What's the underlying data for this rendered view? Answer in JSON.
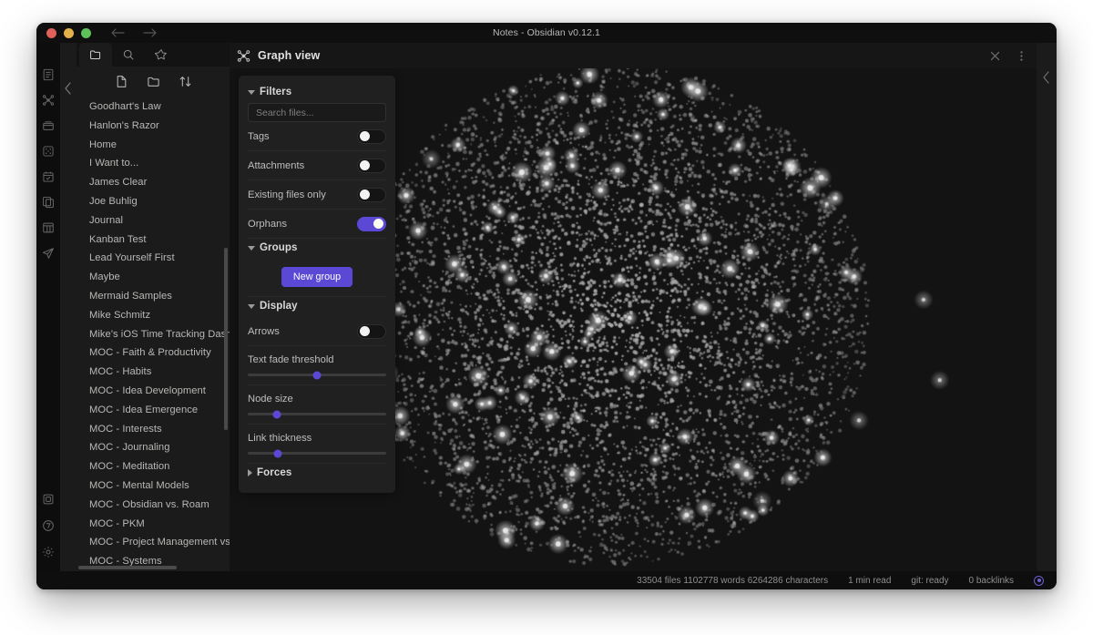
{
  "window": {
    "title": "Notes - Obsidian v0.12.1",
    "traffic": {
      "close": "close-button",
      "minimize": "minimize-button",
      "zoom": "zoom-button"
    },
    "nav": {
      "back": "Back",
      "forward": "Forward"
    }
  },
  "ribbon": {
    "top_items": [
      {
        "name": "daily-note-icon",
        "label": "Open daily note"
      },
      {
        "name": "graph-view-icon",
        "label": "Open graph view"
      },
      {
        "name": "archive-icon",
        "label": "Archive"
      },
      {
        "name": "dice-icon",
        "label": "Random note"
      },
      {
        "name": "calendar-icon",
        "label": "Calendar"
      },
      {
        "name": "templates-icon",
        "label": "Templates"
      },
      {
        "name": "kanban-icon",
        "label": "Kanban board"
      },
      {
        "name": "send-icon",
        "label": "Publish"
      }
    ],
    "bottom_items": [
      {
        "name": "workspace-icon",
        "label": "Manage workspaces"
      },
      {
        "name": "help-icon",
        "label": "Help"
      },
      {
        "name": "settings-icon",
        "label": "Settings"
      }
    ]
  },
  "sidebar": {
    "tabs": [
      {
        "name": "tab-file-explorer",
        "icon": "folder-icon",
        "label": "File explorer",
        "active": true
      },
      {
        "name": "tab-search",
        "icon": "search-icon",
        "label": "Search",
        "active": false
      },
      {
        "name": "tab-starred",
        "icon": "star-icon",
        "label": "Starred",
        "active": false
      }
    ],
    "toolbar": [
      {
        "name": "new-note-button",
        "icon": "new-note-icon",
        "label": "New note"
      },
      {
        "name": "new-folder-button",
        "icon": "new-folder-icon",
        "label": "New folder"
      },
      {
        "name": "sort-button",
        "icon": "sort-icon",
        "label": "Change sort order"
      }
    ],
    "files": [
      "Goodhart's Law",
      "Hanlon's Razor",
      "Home",
      "I Want to...",
      "James Clear",
      "Joe Buhlig",
      "Journal",
      "Kanban Test",
      "Lead Yourself First",
      "Maybe",
      "Mermaid Samples",
      "Mike Schmitz",
      "Mike's iOS Time Tracking Dashbo",
      "MOC - Faith & Productivity",
      "MOC - Habits",
      "MOC - Idea Development",
      "MOC - Idea Emergence",
      "MOC - Interests",
      "MOC - Journaling",
      "MOC - Meditation",
      "MOC - Mental Models",
      "MOC - Obsidian vs. Roam",
      "MOC - PKM",
      "MOC - Project Management vs. T",
      "MOC - Systems"
    ]
  },
  "main": {
    "header": {
      "icon": "graph-view-icon",
      "title": "Graph view",
      "actions": [
        {
          "name": "close-view-button",
          "icon": "close-icon",
          "label": "Close"
        },
        {
          "name": "more-options-button",
          "icon": "more-vertical-icon",
          "label": "More options"
        }
      ]
    },
    "controls": {
      "filters": {
        "title": "Filters",
        "expanded": true,
        "search_placeholder": "Search files...",
        "search_value": "",
        "toggles": [
          {
            "name": "toggle-tags",
            "label": "Tags",
            "on": false
          },
          {
            "name": "toggle-attachments",
            "label": "Attachments",
            "on": false
          },
          {
            "name": "toggle-existing-files-only",
            "label": "Existing files only",
            "on": false
          },
          {
            "name": "toggle-orphans",
            "label": "Orphans",
            "on": true
          }
        ]
      },
      "groups": {
        "title": "Groups",
        "expanded": true,
        "new_group_label": "New group"
      },
      "display": {
        "title": "Display",
        "expanded": true,
        "arrows": {
          "name": "toggle-arrows",
          "label": "Arrows",
          "on": false
        },
        "sliders": [
          {
            "name": "slider-text-fade-threshold",
            "label": "Text fade threshold",
            "percent": 50
          },
          {
            "name": "slider-node-size",
            "label": "Node size",
            "percent": 21
          },
          {
            "name": "slider-link-thickness",
            "label": "Link thickness",
            "percent": 22
          }
        ]
      },
      "forces": {
        "title": "Forces",
        "expanded": false
      }
    }
  },
  "statusbar": {
    "file_stats": "33504 files 1102778 words 6264286 characters",
    "read_time": "1 min read",
    "git_status": "git: ready",
    "backlinks": "0 backlinks",
    "sync_icon": "sync-status-icon"
  },
  "colors": {
    "accent": "#5b49d6",
    "window_bg": "#1e1e1e",
    "panel_bg": "#202020",
    "graph_bg": "#131313",
    "node": "#a9a9a9",
    "text": "#b9b8b6"
  }
}
